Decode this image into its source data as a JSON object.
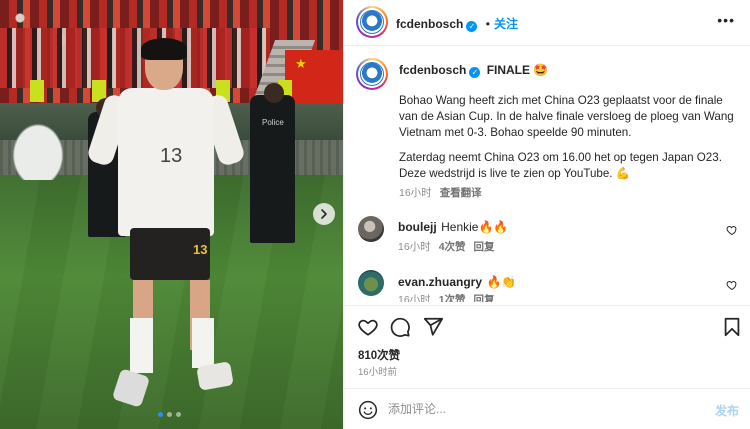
{
  "post": {
    "username": "fcdenbosch",
    "follow_label": "关注",
    "more_label": "•••",
    "title_suffix": "FINALE 🤩",
    "caption_p1": "Bohao Wang heeft zich met China O23 geplaatst voor de finale van de Asian Cup. In de halve finale versloeg de ploeg van Wang Vietnam met 0-3. Bohao speelde 90 minuten.",
    "caption_p2": "Zaterdag neemt China O23 om 16.00 het op tegen Japan O23. Deze wedstrijd is live te zien op YouTube. 💪",
    "caption_time": "16小时",
    "see_translation": "查看翻译",
    "likes": "810次赞",
    "time_ago": "16小时前",
    "photo": {
      "jersey_number": "13",
      "shorts_number": "13",
      "police_text": "Police",
      "carousel_dots": 3,
      "active_dot": 0
    }
  },
  "comments": [
    {
      "username": "boulejj",
      "text": "Henkie🔥🔥",
      "time": "16小时",
      "likes": "4次赞",
      "reply": "回复"
    },
    {
      "username": "evan.zhuangry",
      "text": "🔥👏",
      "time": "16小时",
      "likes": "1次赞",
      "reply": "回复"
    }
  ],
  "composer": {
    "placeholder": "添加评论...",
    "post_label": "发布"
  },
  "icons": [
    "verified-badge-icon",
    "more-icon",
    "heart-icon",
    "comment-icon",
    "share-icon",
    "bookmark-icon",
    "emoji-icon",
    "chevron-right-icon"
  ],
  "colors": {
    "accent": "#0095f6",
    "text": "#262626",
    "muted": "#8e8e8e",
    "border": "#efefef"
  }
}
